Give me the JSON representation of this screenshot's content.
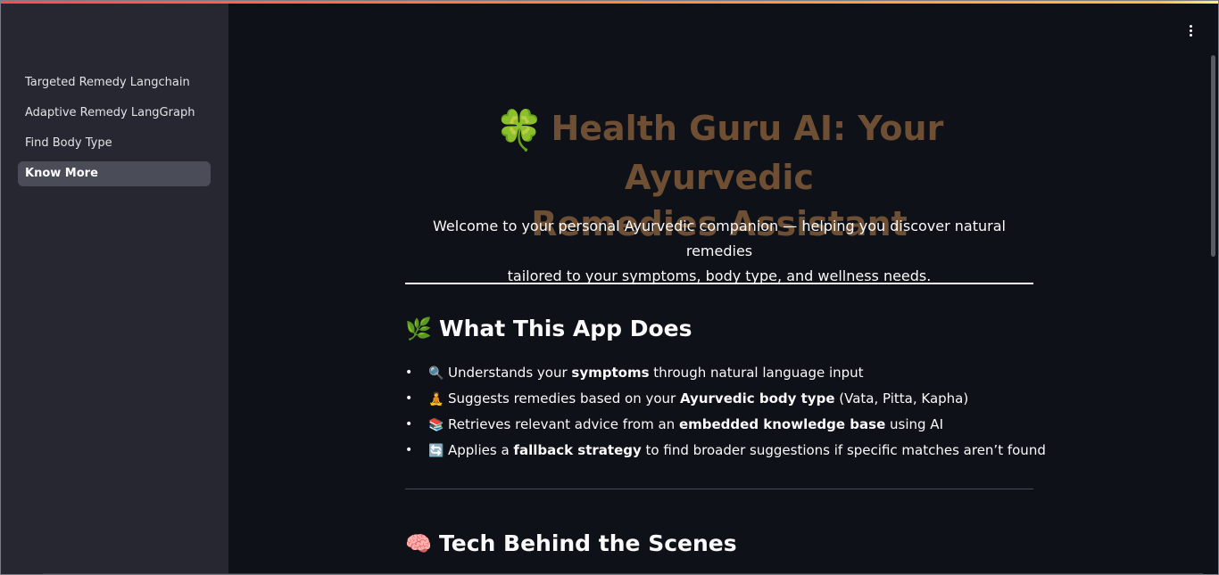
{
  "sidebar": {
    "items": [
      {
        "label": "Targeted Remedy Langchain",
        "active": false
      },
      {
        "label": "Adaptive Remedy LangGraph",
        "active": false
      },
      {
        "label": "Find Body Type",
        "active": false
      },
      {
        "label": "Know More",
        "active": true
      }
    ]
  },
  "header": {
    "menu_icon": "more-vertical-icon"
  },
  "main": {
    "title": {
      "emoji": "🍀",
      "line1": "Health Guru AI: Your Ayurvedic",
      "line2": "Remedies Assistant"
    },
    "welcome": {
      "line1": "Welcome to your personal Ayurvedic companion — helping you discover natural remedies",
      "line2": "tailored to your symptoms, body type, and wellness needs."
    },
    "section1": {
      "emoji": "🌿",
      "heading": "What This App Does",
      "features": [
        {
          "icon": "🔍",
          "pre": "Understands your ",
          "bold": "symptoms",
          "post": " through natural language input"
        },
        {
          "icon": "🧘",
          "pre": "Suggests remedies based on your ",
          "bold": "Ayurvedic body type",
          "post": " (Vata, Pitta, Kapha)"
        },
        {
          "icon": "📚",
          "pre": "Retrieves relevant advice from an ",
          "bold": "embedded knowledge base",
          "post": " using AI"
        },
        {
          "icon": "🔄",
          "pre": "Applies a ",
          "bold": "fallback strategy",
          "post": " to find broader suggestions if specific matches aren’t found"
        }
      ]
    },
    "section2": {
      "emoji": "🧠",
      "heading": "Tech Behind the Scenes"
    }
  },
  "colors": {
    "background": "#0e1117",
    "sidebar": "#262730",
    "title": "#6e4f34",
    "active_nav": "#4a4c57"
  }
}
